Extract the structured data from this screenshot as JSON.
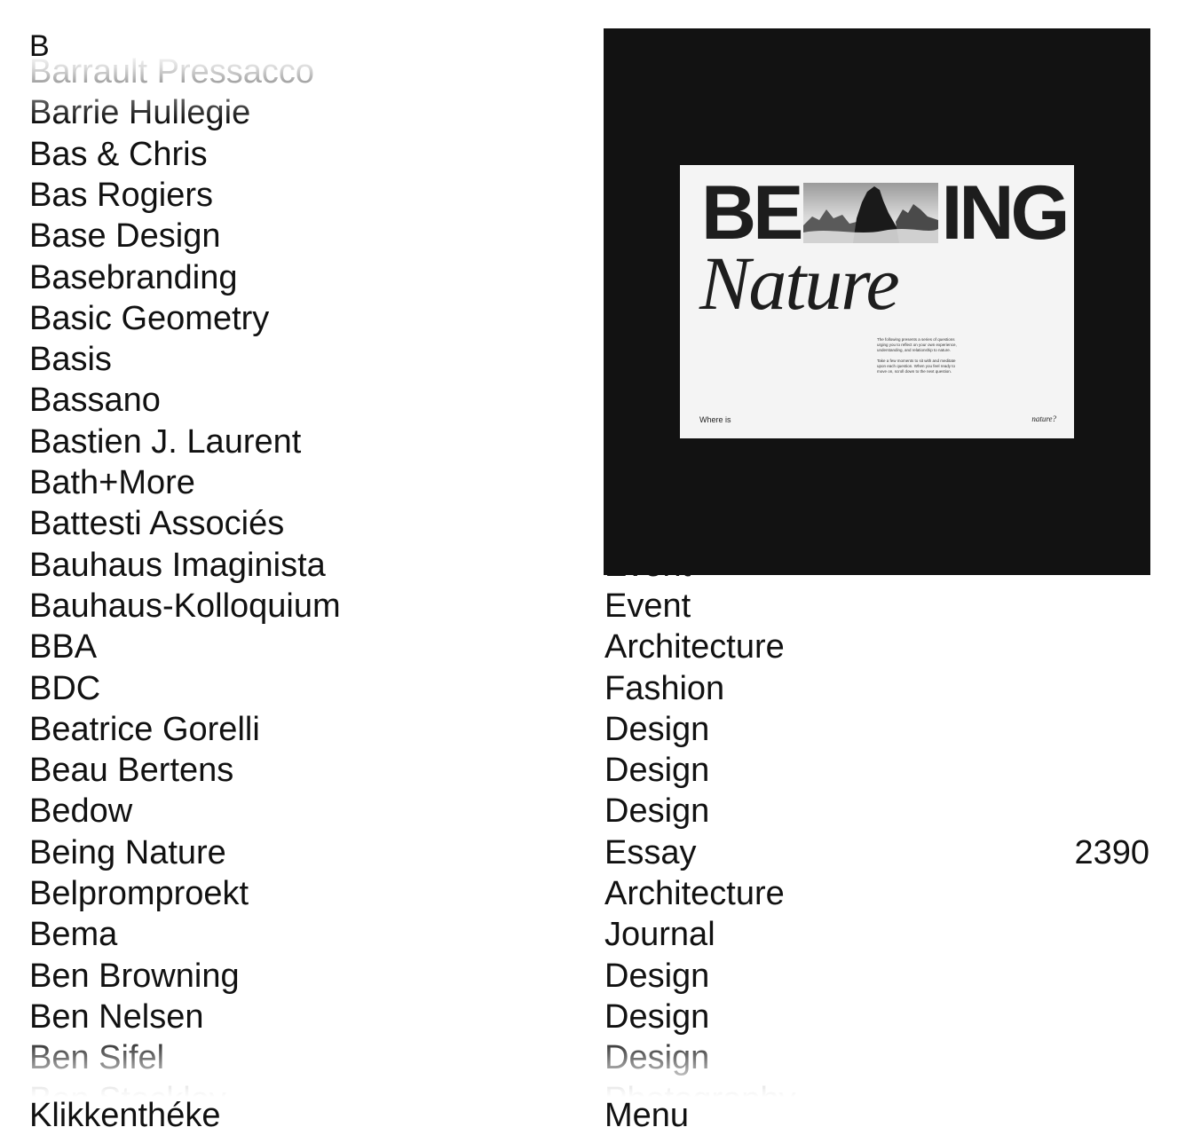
{
  "index": {
    "letter": "B",
    "entries": [
      {
        "name": "Barrault Pressacco",
        "category": "",
        "count": ""
      },
      {
        "name": "Barrie Hullegie",
        "category": "",
        "count": ""
      },
      {
        "name": "Bas & Chris",
        "category": "",
        "count": ""
      },
      {
        "name": "Bas Rogiers",
        "category": "",
        "count": ""
      },
      {
        "name": "Base Design",
        "category": "",
        "count": ""
      },
      {
        "name": "Basebranding",
        "category": "",
        "count": ""
      },
      {
        "name": "Basic Geometry",
        "category": "",
        "count": ""
      },
      {
        "name": "Basis",
        "category": "",
        "count": ""
      },
      {
        "name": "Bassano",
        "category": "",
        "count": ""
      },
      {
        "name": "Bastien J. Laurent",
        "category": "",
        "count": ""
      },
      {
        "name": "Bath+More",
        "category": "",
        "count": ""
      },
      {
        "name": "Battesti Associés",
        "category": "",
        "count": ""
      },
      {
        "name": "Bauhaus Imaginista",
        "category": "Event",
        "count": ""
      },
      {
        "name": "Bauhaus-Kolloquium",
        "category": "Event",
        "count": ""
      },
      {
        "name": "BBA",
        "category": "Architecture",
        "count": ""
      },
      {
        "name": "BDC",
        "category": "Fashion",
        "count": ""
      },
      {
        "name": "Beatrice Gorelli",
        "category": "Design",
        "count": ""
      },
      {
        "name": "Beau Bertens",
        "category": "Design",
        "count": ""
      },
      {
        "name": "Bedow",
        "category": "Design",
        "count": ""
      },
      {
        "name": "Being Nature",
        "category": "Essay",
        "count": "2390"
      },
      {
        "name": "Belpromproekt",
        "category": "Architecture",
        "count": ""
      },
      {
        "name": "Bema",
        "category": "Journal",
        "count": ""
      },
      {
        "name": "Ben Browning",
        "category": "Design",
        "count": ""
      },
      {
        "name": "Ben Nelsen",
        "category": "Design",
        "count": ""
      },
      {
        "name": "Ben Sifel",
        "category": "Design",
        "count": ""
      },
      {
        "name": "Ben Stockley",
        "category": "Photography",
        "count": ""
      }
    ]
  },
  "preview": {
    "title_left": "BE",
    "title_right": "ING",
    "subtitle": "Nature",
    "body_paragraphs": [
      "The following presents a series of questions urging you to reflect on your own experience, understanding, and relationship to nature.",
      "Take a few moments to sit with and meditate upon each question. When you feel ready to move on, scroll down to the next question."
    ],
    "footer_left": "Where is",
    "footer_right": "nature?"
  },
  "footer": {
    "site_name": "Klikkenthéke",
    "menu_label": "Menu"
  }
}
